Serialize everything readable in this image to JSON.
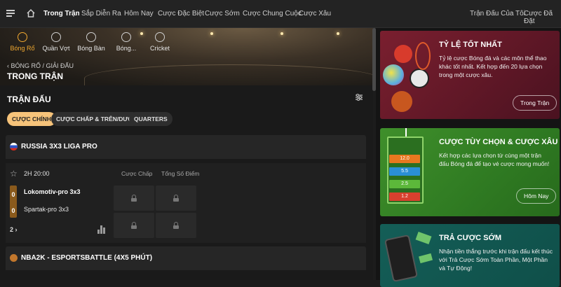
{
  "topnav": {
    "items": [
      "Trong Trận",
      "Sắp Diễn Ra",
      "Hôm Nay",
      "Cược Đặc Biệt",
      "Cược Sớm",
      "Cược Chung Cuộc",
      "Cược Xâu"
    ],
    "right_items": [
      "Trận Đấu Của Tôi",
      "Cược Đã Đặt"
    ]
  },
  "sports": [
    "Bóng Rổ",
    "Quần Vợt",
    "Bóng Bàn",
    "Bóng...",
    "Cricket"
  ],
  "breadcrumb": "BÓNG RỔ / GIẢI ĐẤU",
  "page_title": "TRONG TRẬN",
  "section_title": "TRẬN ĐẤU",
  "filters": [
    "CƯỢC CHÍNH",
    "CƯỢC CHẤP & TRÊN/DƯỚI",
    "QUARTERS"
  ],
  "leagues": [
    {
      "name": "RUSSIA 3X3 LIGA PRO",
      "match": {
        "time": "2H 20:00",
        "market_headers": [
          "Cược Chấp",
          "Tổng Số Điểm"
        ],
        "teams": [
          {
            "name": "Lokomotiv-pro 3x3",
            "score": "0"
          },
          {
            "name": "Spartak-pro 3x3",
            "score": "0"
          }
        ],
        "more": "2"
      }
    },
    {
      "name": "NBA2K - ESPORTSBATTLE (4X5 PHÚT)"
    }
  ],
  "promos": [
    {
      "title": "TỶ LỆ TỐT NHẤT",
      "desc": "Tỷ lệ cược Bóng đá và các môn thể thao khác tốt nhất. Kết hợp đến 20 lựa chọn trong một cược xâu.",
      "button": "Trong Trận"
    },
    {
      "title": "CƯỢC TÙY CHỌN & CƯỢC XÂU",
      "desc": "Kết hợp các lựa chọn từ cùng một trận đấu Bóng đá để tạo vé cược mong muốn!",
      "button": "Hôm Nay",
      "odds": [
        "12.0",
        "5.5",
        "2.5",
        "1.2"
      ]
    },
    {
      "title": "TRẢ CƯỢC SỚM",
      "desc": "Nhận tiền thắng trước khi trận đấu kết thúc với Trả Cược Sớm Toàn Phần, Một Phần và Tự Động!"
    }
  ],
  "colors": {
    "accent": "#f6c37a",
    "active_sport": "#f0a830",
    "promo1": "#6b1b2b",
    "promo2": "#3a8a28",
    "promo3": "#135a53"
  }
}
